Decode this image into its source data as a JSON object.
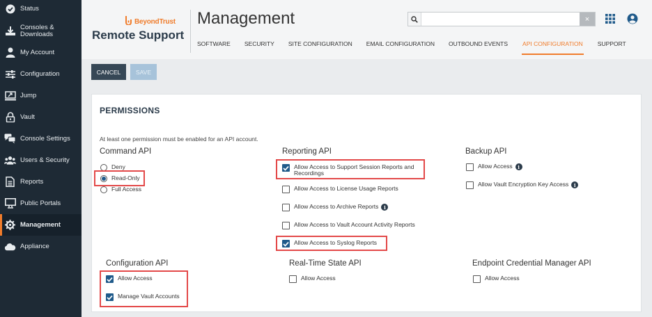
{
  "sidebar": {
    "items": [
      {
        "label": "Status",
        "icon": "status-check-icon"
      },
      {
        "label": "Consoles & Downloads",
        "icon": "download-icon"
      },
      {
        "label": "My Account",
        "icon": "user-icon"
      },
      {
        "label": "Configuration",
        "icon": "sliders-icon"
      },
      {
        "label": "Jump",
        "icon": "jump-icon"
      },
      {
        "label": "Vault",
        "icon": "lock-icon"
      },
      {
        "label": "Console Settings",
        "icon": "chat-icon"
      },
      {
        "label": "Users & Security",
        "icon": "users-icon"
      },
      {
        "label": "Reports",
        "icon": "report-icon"
      },
      {
        "label": "Public Portals",
        "icon": "monitor-icon"
      },
      {
        "label": "Management",
        "icon": "gear-icon"
      },
      {
        "label": "Appliance",
        "icon": "cloud-icon"
      }
    ],
    "active": "Management"
  },
  "header": {
    "brand": "BeyondTrust",
    "product": "Remote Support",
    "title": "Management",
    "tabs": [
      "SOFTWARE",
      "SECURITY",
      "SITE CONFIGURATION",
      "EMAIL CONFIGURATION",
      "OUTBOUND EVENTS",
      "API CONFIGURATION",
      "SUPPORT"
    ],
    "active_tab": "API CONFIGURATION",
    "search_value": "",
    "clear_symbol": "×"
  },
  "actions": {
    "cancel": "CANCEL",
    "save": "SAVE"
  },
  "permissions": {
    "title": "PERMISSIONS",
    "note": "At least one permission must be enabled for an API account.",
    "command_api": {
      "title": "Command API",
      "options": [
        {
          "label": "Deny",
          "checked": false
        },
        {
          "label": "Read-Only",
          "checked": true
        },
        {
          "label": "Full Access",
          "checked": false
        }
      ]
    },
    "reporting_api": {
      "title": "Reporting API",
      "options": [
        {
          "label": "Allow Access to Support Session Reports and Recordings",
          "checked": true
        },
        {
          "label": "Allow Access to License Usage Reports",
          "checked": false
        },
        {
          "label": "Allow Access to Archive Reports",
          "checked": false
        },
        {
          "label": "Allow Access to Vault Account Activity Reports",
          "checked": false
        },
        {
          "label": "Allow Access to Syslog Reports",
          "checked": true
        }
      ]
    },
    "backup_api": {
      "title": "Backup API",
      "options": [
        {
          "label": "Allow Access",
          "checked": false
        },
        {
          "label": "Allow Vault Encryption Key Access",
          "checked": false
        }
      ]
    },
    "configuration_api": {
      "title": "Configuration API",
      "options": [
        {
          "label": "Allow Access",
          "checked": true
        },
        {
          "label": "Manage Vault Accounts",
          "checked": true
        }
      ]
    },
    "realtime_api": {
      "title": "Real-Time State API",
      "options": [
        {
          "label": "Allow Access",
          "checked": false
        }
      ]
    },
    "endpoint_api": {
      "title": "Endpoint Credential Manager API",
      "options": [
        {
          "label": "Allow Access",
          "checked": false
        }
      ]
    },
    "info_symbol": "i"
  },
  "colors": {
    "accent": "#f07c2b",
    "sidebar": "#1e2a35",
    "check": "#1f5a8a",
    "highlight": "#e34848"
  }
}
